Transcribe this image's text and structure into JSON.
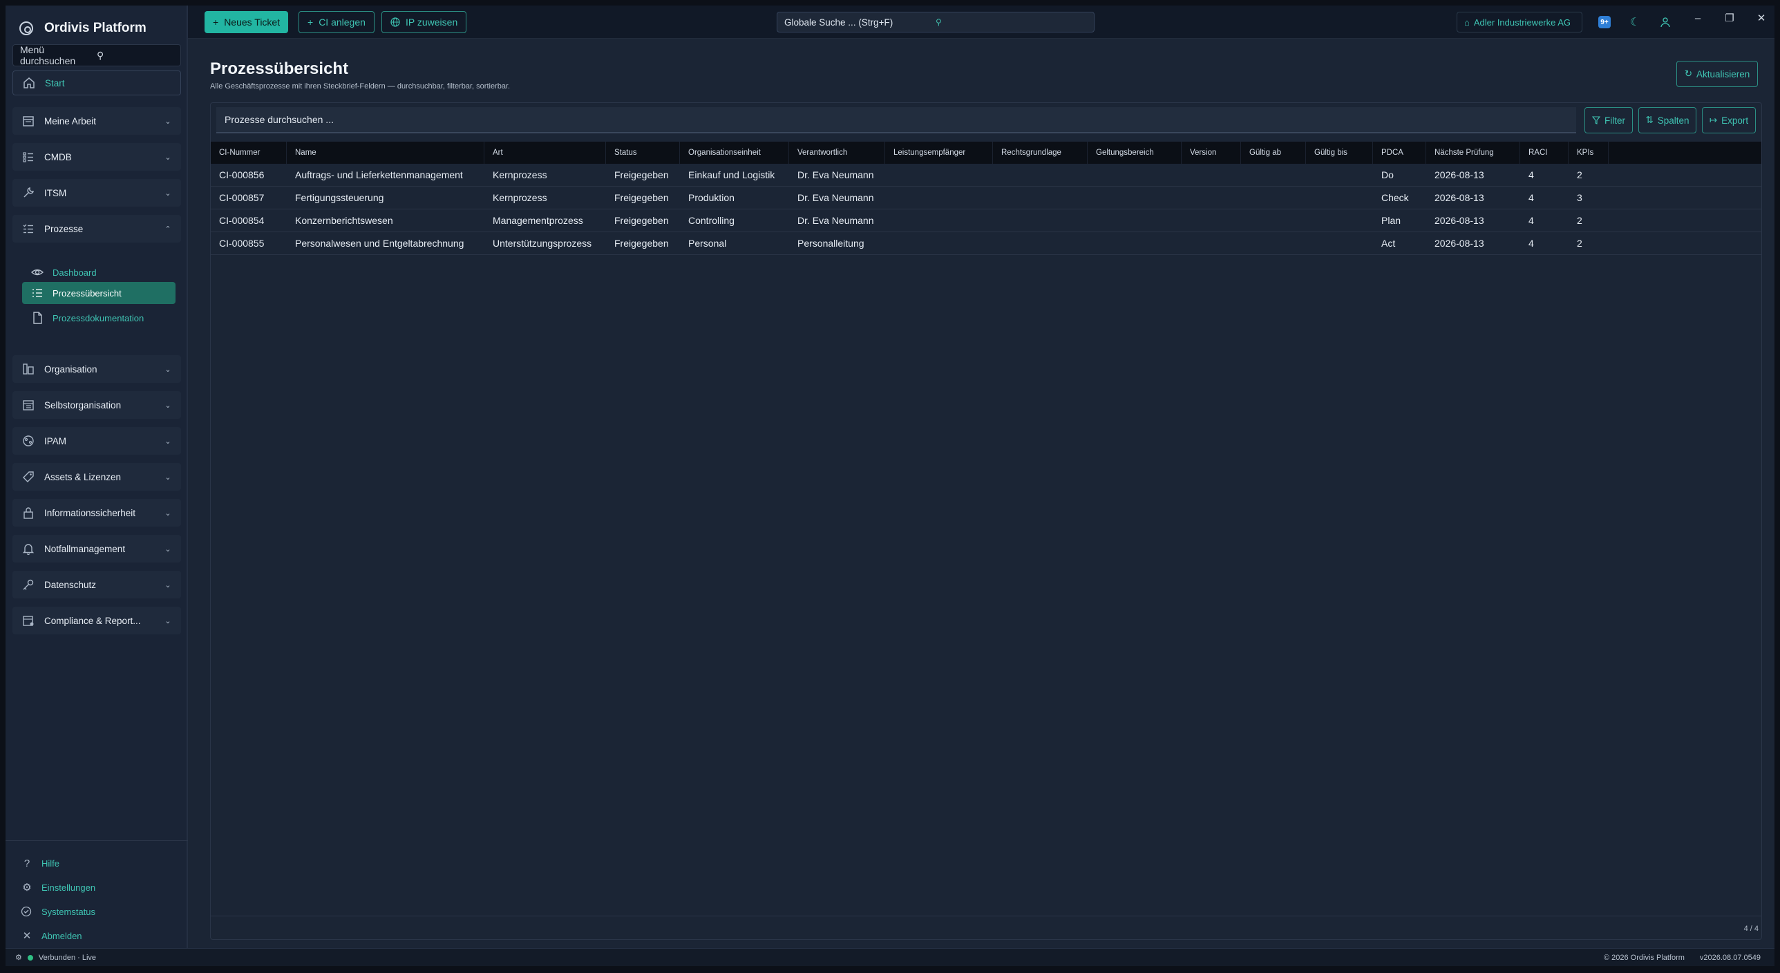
{
  "app": {
    "title": "Ordivis Platform"
  },
  "sidebar": {
    "search_placeholder": "Menü durchsuchen",
    "items": [
      {
        "label": "Start"
      },
      {
        "label": "Meine Arbeit"
      },
      {
        "label": "CMDB"
      },
      {
        "label": "ITSM"
      },
      {
        "label": "Prozesse"
      },
      {
        "label": "Organisation"
      },
      {
        "label": "Selbstorganisation"
      },
      {
        "label": "IPAM"
      },
      {
        "label": "Assets & Lizenzen"
      },
      {
        "label": "Informationssicherheit"
      },
      {
        "label": "Notfallmanagement"
      },
      {
        "label": "Datenschutz"
      },
      {
        "label": "Compliance & Report..."
      }
    ],
    "subitems": [
      {
        "label": "Dashboard"
      },
      {
        "label": "Prozessübersicht"
      },
      {
        "label": "Prozessdokumentation"
      }
    ],
    "footer": [
      {
        "label": "Hilfe"
      },
      {
        "label": "Einstellungen"
      },
      {
        "label": "Systemstatus"
      },
      {
        "label": "Abmelden"
      }
    ]
  },
  "topbar": {
    "new_ticket": "Neues Ticket",
    "ci_create": "CI anlegen",
    "ip_assign": "IP zuweisen",
    "global_search": "Globale Suche ... (Strg+F)",
    "tenant": "Adler Industriewerke AG",
    "badge": "9+"
  },
  "page": {
    "title": "Prozessübersicht",
    "subtitle": "Alle Geschäftsprozesse mit ihren Steckbrief-Feldern — durchsuchbar, filterbar, sortierbar.",
    "refresh": "Aktualisieren"
  },
  "table": {
    "search_placeholder": "Prozesse durchsuchen ...",
    "filter": "Filter",
    "columns_btn": "Spalten",
    "export": "Export",
    "columns": [
      "CI-Nummer",
      "Name",
      "Art",
      "Status",
      "Organisationseinheit",
      "Verantwortlich",
      "Leistungsempfänger",
      "Rechtsgrundlage",
      "Geltungsbereich",
      "Version",
      "Gültig ab",
      "Gültig bis",
      "PDCA",
      "Nächste Prüfung",
      "RACI",
      "KPIs"
    ],
    "rows": [
      [
        "CI-000856",
        "Auftrags- und Lieferkettenmanagement",
        "Kernprozess",
        "Freigegeben",
        "Einkauf und Logistik",
        "Dr. Eva Neumann",
        "",
        "",
        "",
        "",
        "",
        "",
        "Do",
        "2026-08-13",
        "4",
        "2"
      ],
      [
        "CI-000857",
        "Fertigungssteuerung",
        "Kernprozess",
        "Freigegeben",
        "Produktion",
        "Dr. Eva Neumann",
        "",
        "",
        "",
        "",
        "",
        "",
        "Check",
        "2026-08-13",
        "4",
        "3"
      ],
      [
        "CI-000854",
        "Konzernberichtswesen",
        "Managementprozess",
        "Freigegeben",
        "Controlling",
        "Dr. Eva Neumann",
        "",
        "",
        "",
        "",
        "",
        "",
        "Plan",
        "2026-08-13",
        "4",
        "2"
      ],
      [
        "CI-000855",
        "Personalwesen und Entgeltabrechnung",
        "Unterstützungsprozess",
        "Freigegeben",
        "Personal",
        "Personalleitung",
        "",
        "",
        "",
        "",
        "",
        "",
        "Act",
        "2026-08-13",
        "4",
        "2"
      ]
    ],
    "count": "4 / 4"
  },
  "statusbar": {
    "connection": "Verbunden · Live",
    "copyright": "© 2026 Ordivis Platform",
    "version": "v2026.08.07.0549"
  },
  "colors": {
    "accent": "#22b5a2",
    "accent_text": "#3fc4b3",
    "active_sub": "#1f6f63",
    "background": "#1b2535"
  }
}
